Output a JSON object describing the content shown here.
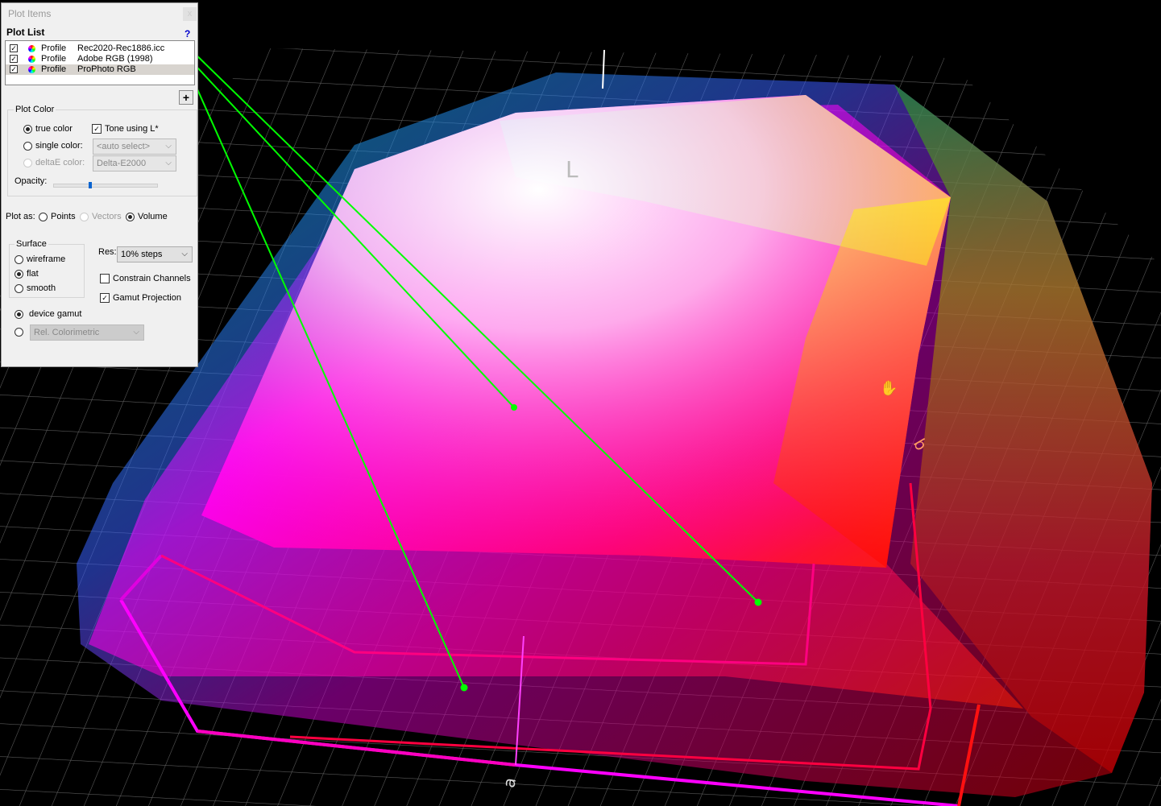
{
  "panel": {
    "title": "Plot Items",
    "close_label": "x",
    "plot_list_heading": "Plot List",
    "help_label": "?",
    "items": [
      {
        "type": "Profile",
        "name": "Rec2020-Rec1886.icc",
        "checked": true
      },
      {
        "type": "Profile",
        "name": "Adobe RGB (1998)",
        "checked": true
      },
      {
        "type": "Profile",
        "name": "ProPhoto RGB",
        "checked": true
      }
    ],
    "add_label": "+",
    "plot_color": {
      "heading": "Plot Color",
      "true_color": "true color",
      "single_color": "single color:",
      "deltae_color": "deltaE color:",
      "tone_using": "Tone using L*",
      "single_select": "<auto select>",
      "deltae_select": "Delta-E2000",
      "opacity_label": "Opacity:",
      "opacity_value": 0.35
    },
    "plot_as": {
      "label": "Plot as:",
      "points": "Points",
      "vectors": "Vectors",
      "volume": "Volume"
    },
    "surface": {
      "heading": "Surface",
      "wireframe": "wireframe",
      "flat": "flat",
      "smooth": "smooth"
    },
    "res_label": "Res:",
    "res_value": "10% steps",
    "constrain_channels": "Constrain Channels",
    "gamut_projection": "Gamut Projection",
    "device_gamut": "device gamut",
    "intent_select": "Rel. Colorimetric"
  },
  "view": {
    "axis_L": "L",
    "axis_b": "b",
    "axis_a": "a",
    "leader_color": "#00ff00"
  }
}
